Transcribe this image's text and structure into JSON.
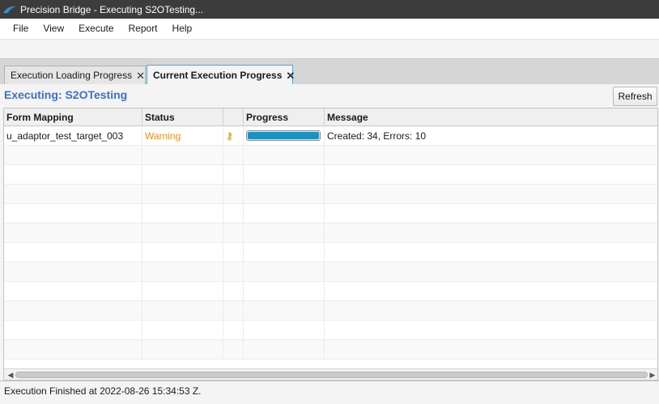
{
  "window": {
    "title": "Precision Bridge - Executing S2OTesting..."
  },
  "menu": [
    "File",
    "View",
    "Execute",
    "Report",
    "Help"
  ],
  "tabs": [
    {
      "label": "Execution Loading Progress",
      "active": false
    },
    {
      "label": "Current Execution Progress",
      "active": true
    }
  ],
  "execution": {
    "title": "Executing: S2OTesting",
    "refresh_label": "Refresh"
  },
  "table": {
    "columns": [
      "Form Mapping",
      "Status",
      "",
      "Progress",
      "Message"
    ],
    "rows": [
      {
        "form_mapping": "u_adaptor_test_target_003",
        "status": "Warning",
        "icon": "key-icon",
        "progress": 1.0,
        "message": "Created: 34, Errors: 10"
      }
    ]
  },
  "statusbar": {
    "text": "Execution Finished at 2022-08-26 15:34:53 Z."
  },
  "colors": {
    "title_bar": "#3c3c3c",
    "accent_title": "#3a6fd0",
    "warning": "#e8901c",
    "progress": "#1a92c4",
    "active_tab_border": "#4aa6d8"
  }
}
